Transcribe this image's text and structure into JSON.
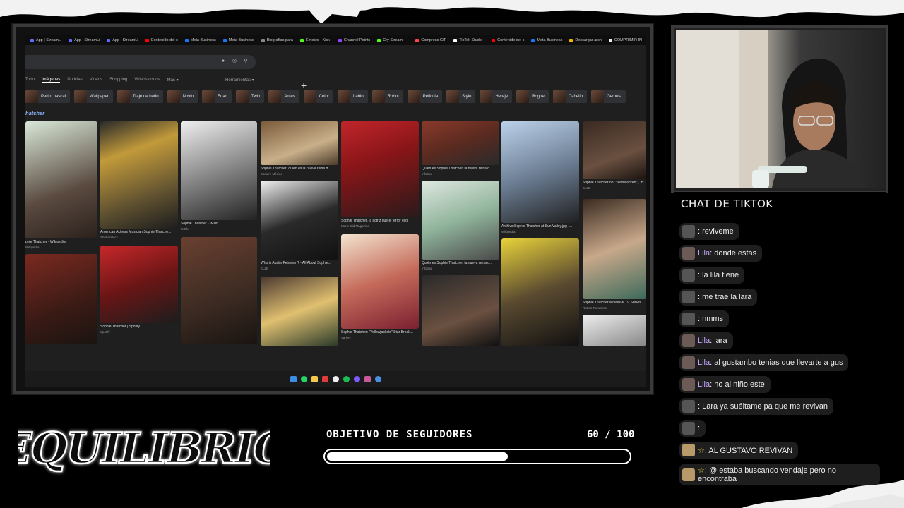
{
  "browser": {
    "tabs": [
      {
        "label": "App | StreamLi",
        "color": "#5b6cff"
      },
      {
        "label": "App | StreamLi",
        "color": "#5b6cff"
      },
      {
        "label": "App | StreamLi",
        "color": "#5b6cff"
      },
      {
        "label": "Contenido del c",
        "color": "#ff0000"
      },
      {
        "label": "Meta Business",
        "color": "#1877f2"
      },
      {
        "label": "Meta Business",
        "color": "#1877f2"
      },
      {
        "label": "Biografías para",
        "color": "#888888"
      },
      {
        "label": "Emotes - Kick",
        "color": "#53fc18"
      },
      {
        "label": "Channel Points",
        "color": "#9146ff"
      },
      {
        "label": "Cry Stream",
        "color": "#53fc18"
      },
      {
        "label": "Compress GIF",
        "color": "#ff4444"
      },
      {
        "label": "TikTok Studio",
        "color": "#ffffff"
      },
      {
        "label": "Contenido del c",
        "color": "#ff0000"
      },
      {
        "label": "Meta Business",
        "color": "#1877f2"
      },
      {
        "label": "Descargar arch",
        "color": "#f4b400"
      },
      {
        "label": "COMPRIMIR IN",
        "color": "#eeeeee"
      }
    ],
    "search_tabs": {
      "all": "Todo",
      "images": "Imágenes",
      "news": "Noticias",
      "videos": "Videos",
      "shopping": "Shopping",
      "short_videos": "Videos cortos",
      "more": "Más"
    },
    "tools_label": "Herramientas",
    "chips": [
      "Pedro pascal",
      "Wallpaper",
      "Traje de baño",
      "Novio",
      "Edad",
      "Twin",
      "Antes",
      "Color",
      "Labio",
      "Robot",
      "Película",
      "Style",
      "Hereje",
      "Rogue",
      "Cabello",
      "Gemela"
    ],
    "query": "hatcher",
    "results": [
      {
        "caption": "phie Thatcher · Wikipedia",
        "source": "Wikipedia"
      },
      {
        "caption": "American Actress Musician Sophie Thatche...",
        "source": "Shutterstock"
      },
      {
        "caption": "Sophie Thatcher - IMDb",
        "source": "IMDb"
      },
      {
        "caption": "Sophie Thatcher: quién es la nueva reina d...",
        "source": "Esquire México"
      },
      {
        "caption": "Sophie Thatcher, la actriz que el terror eligi",
        "source": "Marie Cid Magazine"
      },
      {
        "caption": "Quién es Sophie Thatcher, la nueva reina d...",
        "source": "Infobae"
      },
      {
        "caption": "Archivo:Sophie Thatcher at Sun Valley.jpg -...",
        "source": "Wikipedia"
      },
      {
        "caption": "Sophie Thatcher on \"Yellowjackets\", \"H...",
        "source": "ELLE"
      },
      {
        "caption": "Who is Austin Feinstein? - All About Sophie...",
        "source": "ELLE"
      },
      {
        "caption": "Quién es Sophie Thatcher, la nueva reina d...",
        "source": "Infobae"
      },
      {
        "caption": "Sophie Thatcher | Spotify",
        "source": "Spotify"
      },
      {
        "caption": "Sophie Thatcher Movies & TV Shows",
        "source": "Rotten Tomatoes"
      },
      {
        "caption": "Sophie Thatcher: \"Yellowjackets\" Star Break...",
        "source": "Variety"
      }
    ]
  },
  "chat": {
    "title": "CHAT DE TIKTOK",
    "messages": [
      {
        "name": "",
        "text": ": reviveme",
        "avatar": "#555555"
      },
      {
        "name": "Lila",
        "text": ": donde estas",
        "avatar": "#6b5a55"
      },
      {
        "name": "",
        "text": ": la lila tiene",
        "avatar": "#555555"
      },
      {
        "name": "",
        "text": ": me trae la lara",
        "avatar": "#555555"
      },
      {
        "name": "",
        "text": ": nmms",
        "avatar": "#555555"
      },
      {
        "name": "Lila",
        "text": ": lara",
        "avatar": "#6b5a55"
      },
      {
        "name": "Lila",
        "text": ": al gustambo tenias que llevarte a gus",
        "avatar": "#6b5a55"
      },
      {
        "name": "Lila",
        "text": ": no al niño este",
        "avatar": "#6b5a55"
      },
      {
        "name": "",
        "text": ": Lara ya suéltame pa que me revivan",
        "avatar": "#555555"
      },
      {
        "name": "",
        "text": ":",
        "avatar": "#555555"
      },
      {
        "name": "",
        "star": "☆",
        "text": ": AL GUSTAVO REVIVAN",
        "avatar": "#b89a6a"
      },
      {
        "name": "",
        "star": "☆",
        "text": ": @ estaba buscando vendaje pero no encontraba",
        "avatar": "#b89a6a"
      }
    ]
  },
  "logo_text": "EQUILIBRIO",
  "goal": {
    "label": "OBJETIVO DE SEGUIDORES",
    "current": "60",
    "separator": "/",
    "target": "100",
    "count_text": "60 / 100",
    "progress": 0.6
  }
}
